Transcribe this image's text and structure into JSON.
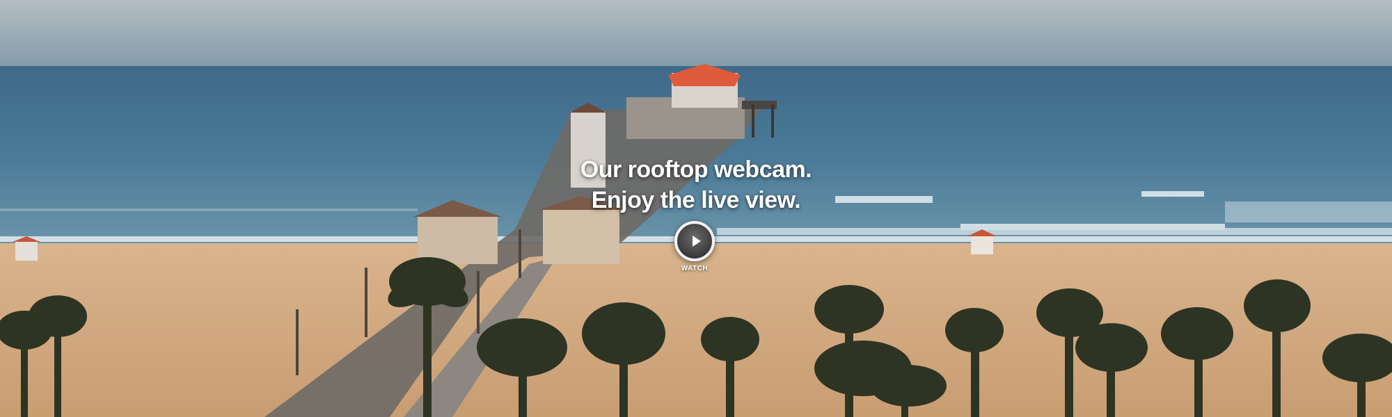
{
  "hero": {
    "headline_line1": "Our rooftop webcam.",
    "headline_line2": "Enjoy the live view.",
    "watch_label": "WATCH"
  },
  "icons": {
    "play": "play-icon"
  },
  "colors": {
    "sky": "#aab6bc",
    "ocean": "#3f6f8f",
    "sand": "#d5ad84",
    "roof": "#e05a3c",
    "palm": "#2f3524",
    "text": "#ffffff"
  }
}
